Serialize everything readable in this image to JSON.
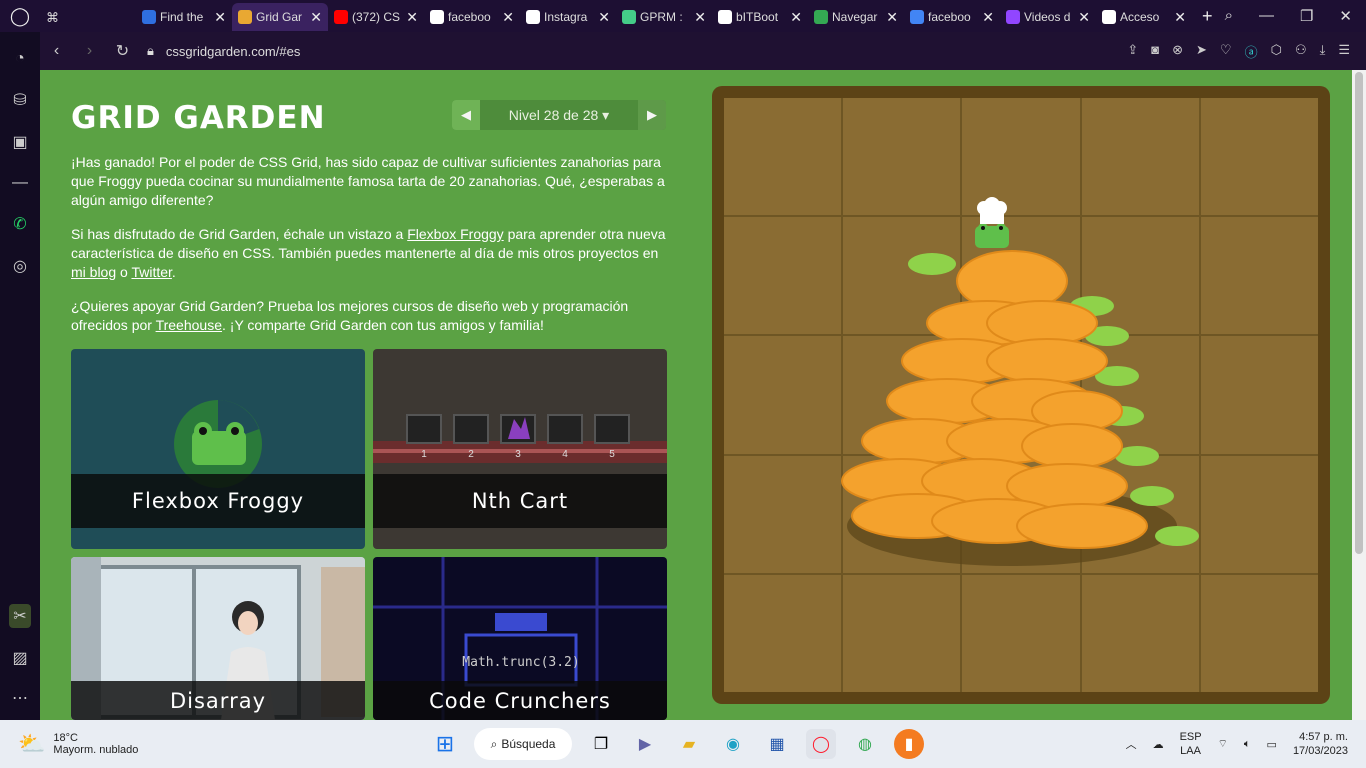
{
  "browser": {
    "tabs": [
      {
        "title": "Find the",
        "color": "#2f6fe0"
      },
      {
        "title": "Grid Gar",
        "color": "#e9a832",
        "active": true
      },
      {
        "title": "(372) CS",
        "color": "#ff0000"
      },
      {
        "title": "faceboo",
        "color": "#ffffff"
      },
      {
        "title": "Instagra",
        "color": "#ffffff"
      },
      {
        "title": "GPRM :",
        "color": "#44cc88"
      },
      {
        "title": "bITBoot",
        "color": "#ffffff"
      },
      {
        "title": "Navegar",
        "color": "#34a853"
      },
      {
        "title": "faceboo",
        "color": "#4285f4"
      },
      {
        "title": "Videos d",
        "color": "#9146ff"
      },
      {
        "title": "Acceso",
        "color": "#ffffff"
      }
    ],
    "url": "cssgridgarden.com/#es"
  },
  "game": {
    "title": "GRID GARDEN",
    "level_label": "Nivel 28 de 28",
    "para1": "¡Has ganado! Por el poder de CSS Grid, has sido capaz de cultivar suficientes zanahorias para que Froggy pueda cocinar su mundialmente famosa tarta de 20 zanahorias. Qué, ¿esperabas a algún amigo diferente?",
    "para2_a": "Si has disfrutado de Grid Garden, échale un vistazo a ",
    "para2_link1": "Flexbox Froggy",
    "para2_b": " para aprender otra nueva característica de diseño en CSS. También puedes mantenerte al día de mis otros proyectos en ",
    "para2_link2": "mi blog",
    "para2_c": " o ",
    "para2_link3": "Twitter",
    "para2_d": ".",
    "para3_a": "¿Quieres apoyar Grid Garden? Prueba los mejores cursos de diseño web y programación ofrecidos por ",
    "para3_link": "Treehouse",
    "para3_b": ". ¡Y comparte Grid Garden con tus amigos y familia!",
    "cards": [
      {
        "label": "Flexbox Froggy"
      },
      {
        "label": "Nth Cart",
        "carts": [
          "1",
          "2",
          "3",
          "4",
          "5"
        ]
      },
      {
        "label": "Disarray"
      },
      {
        "label": "Code Crunchers",
        "code": "Math.trunc(3.2)"
      }
    ]
  },
  "taskbar": {
    "temp": "18°C",
    "weather": "Mayorm. nublado",
    "search": "Búsqueda",
    "lang1": "ESP",
    "lang2": "LAA",
    "time": "4:57 p. m.",
    "date": "17/03/2023"
  }
}
